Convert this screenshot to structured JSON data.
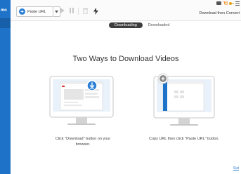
{
  "sidebar": {
    "logo": "mo"
  },
  "toolbar": {
    "paste_url_label": "Paste URL",
    "convert_label": "Download then Convert",
    "icons": [
      "paste-url-plus-icon",
      "dropdown-arrow-icon",
      "resume-icon",
      "pause-icon",
      "delete-icon",
      "turbo-icon",
      "chat-icon",
      "cart-icon",
      "key-icon",
      "menu-icon"
    ]
  },
  "tabs": [
    {
      "label": "Downloading",
      "active": true
    },
    {
      "label": "Downloaded",
      "active": false
    }
  ],
  "main": {
    "title": "Two Ways to Download Videos",
    "way1_caption_line1": "Click \"Download\" button on your",
    "way1_caption_line2": "browser.",
    "way2_caption": "Copy URL then click \"Paste URL\" button."
  },
  "footer": {
    "link": "Sut"
  },
  "colors": {
    "sidebar": "#1e73c8",
    "accent": "#2a7fd4",
    "tab_active": "#3d3d3d",
    "cart": "#f28a1c"
  }
}
